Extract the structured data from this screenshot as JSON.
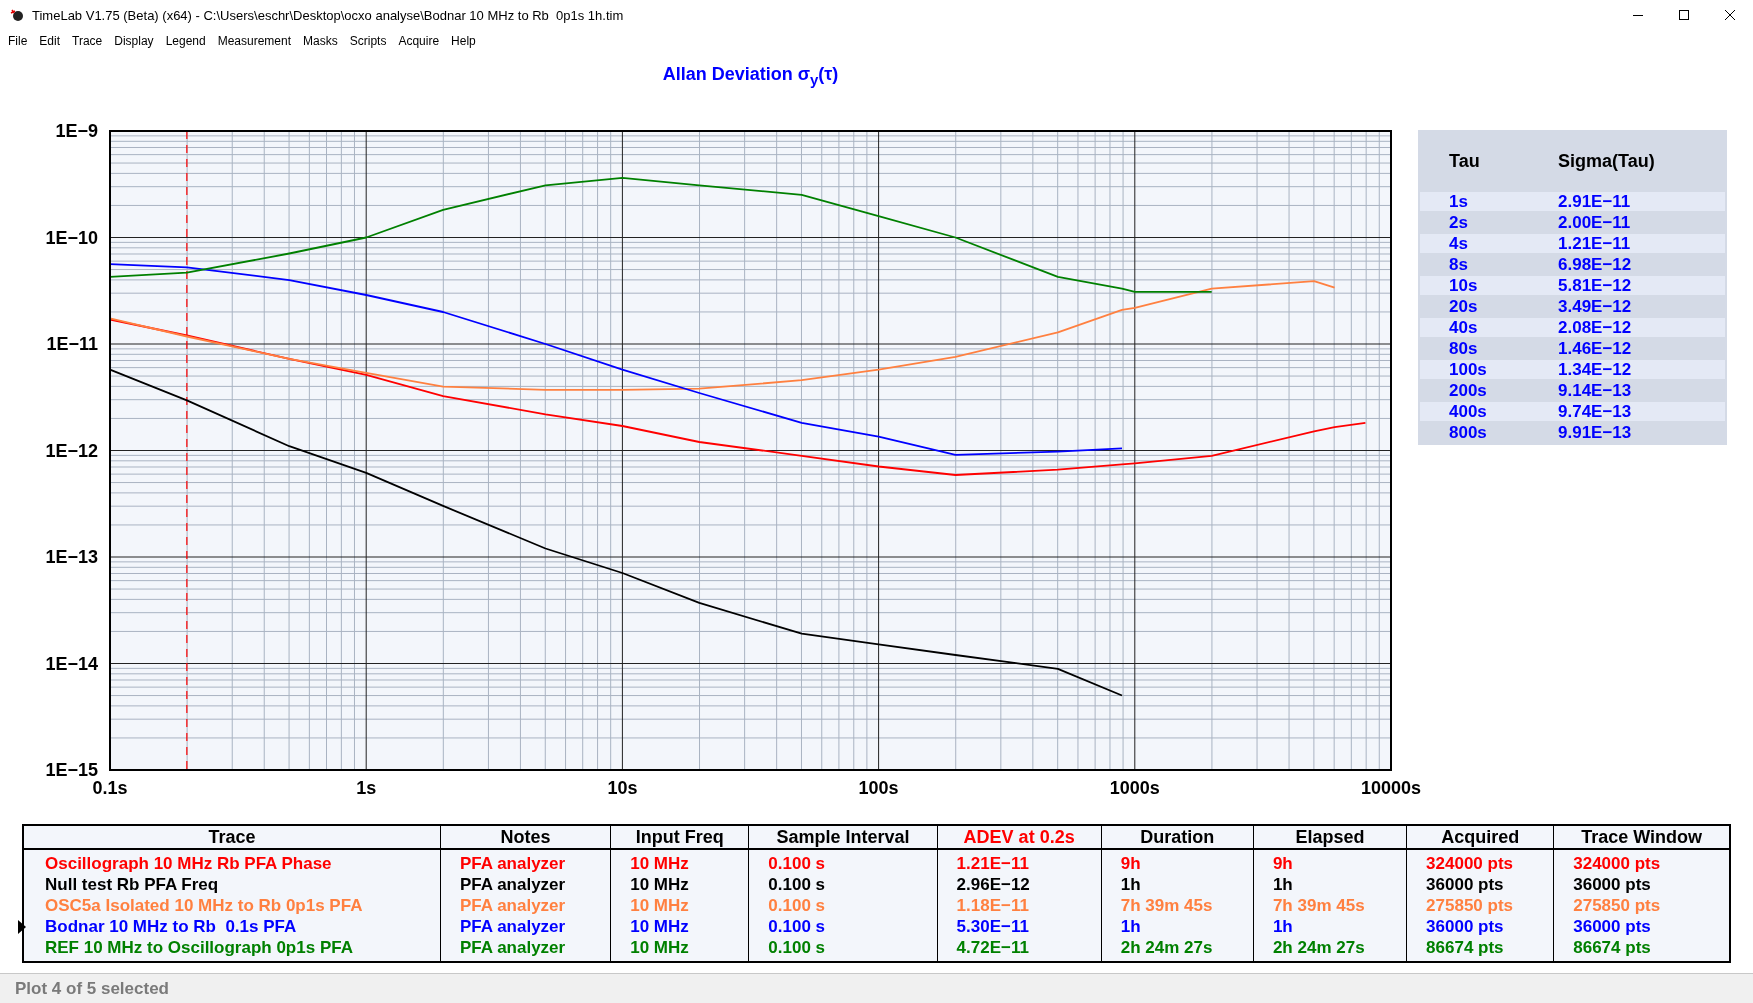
{
  "window": {
    "title": "TimeLab V1.75 (Beta) (x64) - C:\\Users\\eschr\\Desktop\\ocxo analyse\\Bodnar 10 MHz to Rb  0p1s 1h.tim"
  },
  "menu": [
    "File",
    "Edit",
    "Trace",
    "Display",
    "Legend",
    "Measurement",
    "Masks",
    "Scripts",
    "Acquire",
    "Help"
  ],
  "plot": {
    "title": "Allan Deviation σ$_{y}$(τ)",
    "x_axis_labels": [
      "0.1s",
      "1s",
      "10s",
      "100s",
      "1000s",
      "10000s"
    ],
    "y_axis_labels": [
      "1E−9",
      "1E−10",
      "1E−11",
      "1E−12",
      "1E−13",
      "1E−14",
      "1E−15"
    ]
  },
  "tau_table": {
    "columns": [
      "Tau",
      "Sigma(Tau)"
    ],
    "rows": [
      {
        "tau": "1s",
        "sigma": "2.91E−11"
      },
      {
        "tau": "2s",
        "sigma": "2.00E−11"
      },
      {
        "tau": "4s",
        "sigma": "1.21E−11"
      },
      {
        "tau": "8s",
        "sigma": "6.98E−12"
      },
      {
        "tau": "10s",
        "sigma": "5.81E−12"
      },
      {
        "tau": "20s",
        "sigma": "3.49E−12"
      },
      {
        "tau": "40s",
        "sigma": "2.08E−12"
      },
      {
        "tau": "80s",
        "sigma": "1.46E−12"
      },
      {
        "tau": "100s",
        "sigma": "1.34E−12"
      },
      {
        "tau": "200s",
        "sigma": "9.14E−13"
      },
      {
        "tau": "400s",
        "sigma": "9.74E−13"
      },
      {
        "tau": "800s",
        "sigma": "9.91E−13"
      }
    ]
  },
  "traces_table": {
    "columns": [
      {
        "label": "Trace"
      },
      {
        "label": "Notes"
      },
      {
        "label": "Input Freq"
      },
      {
        "label": "Sample Interval"
      },
      {
        "label": "ADEV at 0.2s",
        "color": "#ff0000"
      },
      {
        "label": "Duration"
      },
      {
        "label": "Elapsed"
      },
      {
        "label": "Acquired"
      },
      {
        "label": "Trace Window"
      }
    ],
    "rows": [
      {
        "selected": false,
        "color": "#ff0000",
        "cells": [
          "Oscillograph 10 MHz Rb PFA Phase",
          "PFA analyzer",
          "10 MHz",
          "0.100 s",
          "1.21E−11",
          "9h",
          "9h",
          "324000 pts",
          "324000 pts"
        ]
      },
      {
        "selected": false,
        "color": "#000000",
        "cells": [
          "Null test Rb PFA Freq",
          "PFA analyzer",
          "10 MHz",
          "0.100 s",
          "2.96E−12",
          "1h",
          "1h",
          "36000 pts",
          "36000 pts"
        ]
      },
      {
        "selected": false,
        "color": "#ff8040",
        "cells": [
          "OSC5a Isolated 10 MHz to Rb 0p1s PFA",
          "PFA analyzer",
          "10 MHz",
          "0.100 s",
          "1.18E−11",
          "7h 39m 45s",
          "7h 39m 45s",
          "275850 pts",
          "275850 pts"
        ]
      },
      {
        "selected": true,
        "color": "#0000ff",
        "cells": [
          "Bodnar 10 MHz to Rb  0.1s PFA",
          "PFA analyzer",
          "10 MHz",
          "0.100 s",
          "5.30E−11",
          "1h",
          "1h",
          "36000 pts",
          "36000 pts"
        ]
      },
      {
        "selected": false,
        "color": "#008000",
        "cells": [
          "REF 10 MHz to Oscillograph 0p1s PFA",
          "PFA analyzer",
          "10 MHz",
          "0.100 s",
          "4.72E−11",
          "2h 24m 27s",
          "2h 24m 27s",
          "86674 pts",
          "86674 pts"
        ]
      }
    ]
  },
  "status_bar": "Plot 4 of 5 selected"
}
